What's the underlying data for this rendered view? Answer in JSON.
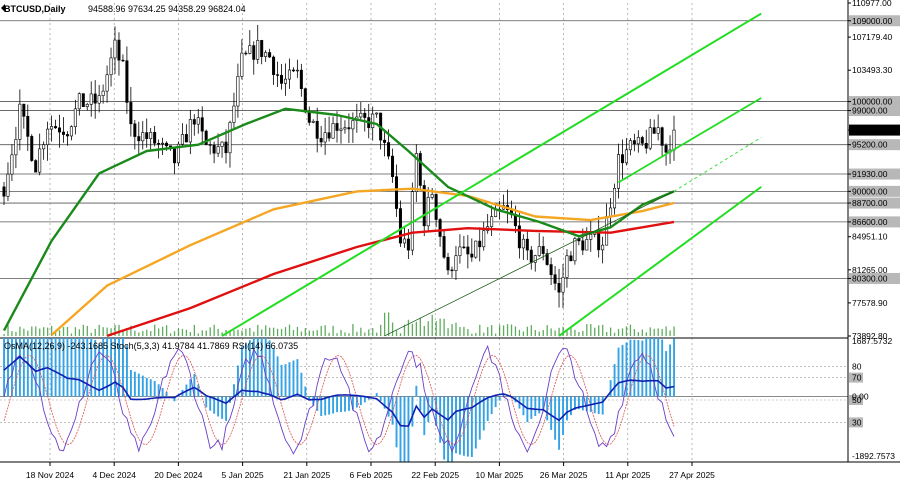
{
  "header": {
    "symbol": "BTCUSD,Daily",
    "ohlc": "94588.96 97634.25 94358.29 96824.04"
  },
  "indicator_header": "OsMA(12,26,9) -243.1685  Stoch(5,3,3) 41.9784 41.7869  RSI(14) 66.0735",
  "colors": {
    "ema_fast": "#1a8a1a",
    "ema_mid": "#f5a623",
    "ema_slow": "#e01010",
    "channel": "#22dd22",
    "candle": "#000000",
    "osma": "#33a3e6",
    "stoch_main": "#6a3fc7",
    "stoch_signal": "#e05050",
    "rsi": "#1020b0",
    "level_line": "#555555"
  },
  "price_axis": {
    "ticks": [
      "110977.00",
      "107179.40",
      "103493.30",
      "100000.00",
      "99000.00",
      "96824.04",
      "95200.00",
      "91930.00",
      "90000.00",
      "88700.00",
      "86600.00",
      "84951.10",
      "81265.00",
      "80300.00",
      "77578.90",
      "73892.80"
    ],
    "highlighted": [
      "109000.00",
      "100000.00",
      "99000.00",
      "96824.04",
      "95200.00",
      "91930.00",
      "90000.00",
      "88700.00",
      "86600.00",
      "80300.00"
    ]
  },
  "indicator_axis": {
    "ticks": [
      "1687.5732",
      "80",
      "70",
      "50",
      "0.00",
      "30",
      "-1892.7573"
    ]
  },
  "date_axis": {
    "labels": [
      "18 Nov 2024",
      "4 Dec 2024",
      "20 Dec 2024",
      "5 Jan 2025",
      "21 Jan 2025",
      "6 Feb 2025",
      "22 Feb 2025",
      "10 Mar 2025",
      "26 Mar 2025",
      "11 Apr 2025",
      "27 Apr 2025"
    ]
  },
  "chart_data": {
    "type": "line",
    "title": "BTCUSD,Daily",
    "last_price": 96824.04,
    "levels": [
      109000,
      100000,
      99000,
      95200,
      91930,
      90000,
      88700,
      86600,
      80300
    ],
    "y_range": [
      73892.8,
      110977
    ],
    "price_path": [
      [
        "2024-11-18",
        90500
      ],
      [
        "2024-11-22",
        98800
      ],
      [
        "2024-11-26",
        93000
      ],
      [
        "2024-11-29",
        97500
      ],
      [
        "2024-12-04",
        97000
      ],
      [
        "2024-12-07",
        99800
      ],
      [
        "2024-12-12",
        100000
      ],
      [
        "2024-12-16",
        106000
      ],
      [
        "2024-12-18",
        103500
      ],
      [
        "2024-12-20",
        97000
      ],
      [
        "2024-12-26",
        95500
      ],
      [
        "2024-12-31",
        93400
      ],
      [
        "2025-01-05",
        98300
      ],
      [
        "2025-01-08",
        95000
      ],
      [
        "2025-01-13",
        94500
      ],
      [
        "2025-01-17",
        104500
      ],
      [
        "2025-01-21",
        106000
      ],
      [
        "2025-01-24",
        105000
      ],
      [
        "2025-01-27",
        102000
      ],
      [
        "2025-01-31",
        103000
      ],
      [
        "2025-02-03",
        98000
      ],
      [
        "2025-02-06",
        96500
      ],
      [
        "2025-02-10",
        97500
      ],
      [
        "2025-02-14",
        97500
      ],
      [
        "2025-02-20",
        98000
      ],
      [
        "2025-02-24",
        91500
      ],
      [
        "2025-02-26",
        84500
      ],
      [
        "2025-02-28",
        84000
      ],
      [
        "2025-03-02",
        94000
      ],
      [
        "2025-03-04",
        87000
      ],
      [
        "2025-03-06",
        90000
      ],
      [
        "2025-03-10",
        80500
      ],
      [
        "2025-03-12",
        83500
      ],
      [
        "2025-03-16",
        82500
      ],
      [
        "2025-03-20",
        86000
      ],
      [
        "2025-03-24",
        88000
      ],
      [
        "2025-03-26",
        87000
      ],
      [
        "2025-03-30",
        82500
      ],
      [
        "2025-04-03",
        83500
      ],
      [
        "2025-04-07",
        78500
      ],
      [
        "2025-04-09",
        82500
      ],
      [
        "2025-04-11",
        84000
      ],
      [
        "2025-04-15",
        84500
      ],
      [
        "2025-04-18",
        84500
      ],
      [
        "2025-04-22",
        93500
      ],
      [
        "2025-04-25",
        94800
      ],
      [
        "2025-04-28",
        95000
      ],
      [
        "2025-05-02",
        97000
      ],
      [
        "2025-05-04",
        94500
      ],
      [
        "2025-05-06",
        96824
      ]
    ],
    "ema_fast": [
      [
        "2024-11-18",
        74500
      ],
      [
        "2024-11-30",
        84500
      ],
      [
        "2024-12-12",
        92000
      ],
      [
        "2024-12-24",
        94500
      ],
      [
        "2025-01-06",
        95200
      ],
      [
        "2025-01-18",
        97500
      ],
      [
        "2025-01-28",
        99200
      ],
      [
        "2025-02-10",
        98500
      ],
      [
        "2025-02-20",
        97500
      ],
      [
        "2025-02-28",
        94500
      ],
      [
        "2025-03-10",
        90500
      ],
      [
        "2025-03-22",
        88000
      ],
      [
        "2025-04-02",
        86600
      ],
      [
        "2025-04-12",
        85000
      ],
      [
        "2025-04-20",
        86000
      ],
      [
        "2025-04-28",
        88500
      ],
      [
        "2025-05-06",
        90000
      ]
    ],
    "ema_mid": [
      [
        "2024-11-30",
        74000
      ],
      [
        "2024-12-14",
        79500
      ],
      [
        "2025-01-04",
        84000
      ],
      [
        "2025-01-25",
        88000
      ],
      [
        "2025-02-15",
        90000
      ],
      [
        "2025-03-01",
        90300
      ],
      [
        "2025-03-15",
        89500
      ],
      [
        "2025-04-01",
        87200
      ],
      [
        "2025-04-15",
        86800
      ],
      [
        "2025-04-28",
        87800
      ],
      [
        "2025-05-06",
        88700
      ]
    ],
    "ema_slow": [
      [
        "2024-12-14",
        73900
      ],
      [
        "2025-01-04",
        77000
      ],
      [
        "2025-01-25",
        80800
      ],
      [
        "2025-02-15",
        83800
      ],
      [
        "2025-03-01",
        85400
      ],
      [
        "2025-03-15",
        85900
      ],
      [
        "2025-04-01",
        85600
      ],
      [
        "2025-04-20",
        85400
      ],
      [
        "2025-05-06",
        86600
      ]
    ],
    "channel_upper": [
      [
        "2025-01-12",
        73900
      ],
      [
        "2025-05-28",
        109800
      ]
    ],
    "channel_lower": [
      [
        "2025-04-07",
        73900
      ],
      [
        "2025-05-28",
        90500
      ]
    ],
    "channel_mid": [
      [
        "2025-02-22",
        73900
      ],
      [
        "2025-05-06",
        90000
      ]
    ],
    "channel_mid_projection": [
      [
        "2025-05-06",
        90000
      ],
      [
        "2025-05-28",
        96000
      ]
    ],
    "channel_extra": [
      [
        "2025-04-22",
        91000
      ],
      [
        "2025-05-28",
        100400
      ]
    ],
    "indicator": {
      "stoch_levels": [
        80,
        70,
        50,
        30
      ],
      "range": [
        -1892.7573,
        1687.5732
      ]
    }
  }
}
